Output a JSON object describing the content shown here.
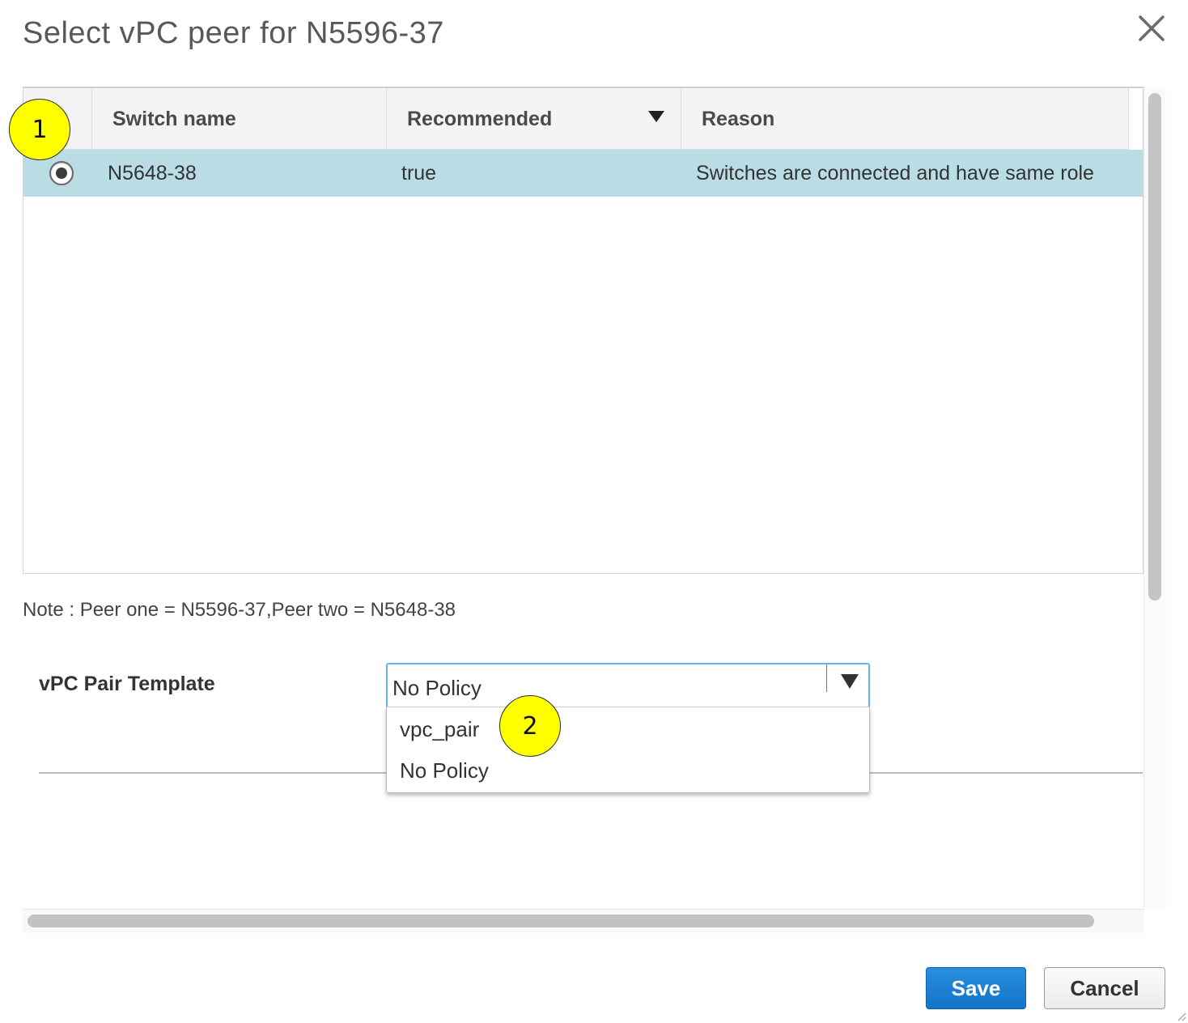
{
  "dialog": {
    "title": "Select vPC peer for N5596-37"
  },
  "table": {
    "columns": [
      "",
      "Switch name",
      "Recommended",
      "Reason"
    ],
    "rows": [
      {
        "selected": true,
        "switch_name": "N5648-38",
        "recommended": "true",
        "reason": "Switches are connected and have same role"
      }
    ]
  },
  "note": "Note : Peer one = N5596-37,Peer two = N5648-38",
  "template_field": {
    "label": "vPC Pair Template",
    "value": "No Policy",
    "options": [
      "vpc_pair",
      "No Policy"
    ]
  },
  "callouts": [
    "1",
    "2"
  ],
  "buttons": {
    "save": "Save",
    "cancel": "Cancel"
  },
  "colors": {
    "selected_row": "#b9dce5",
    "primary_button": "#1a7fd6",
    "callout": "#ffff00",
    "select_focus_border": "#5fb8e8"
  }
}
